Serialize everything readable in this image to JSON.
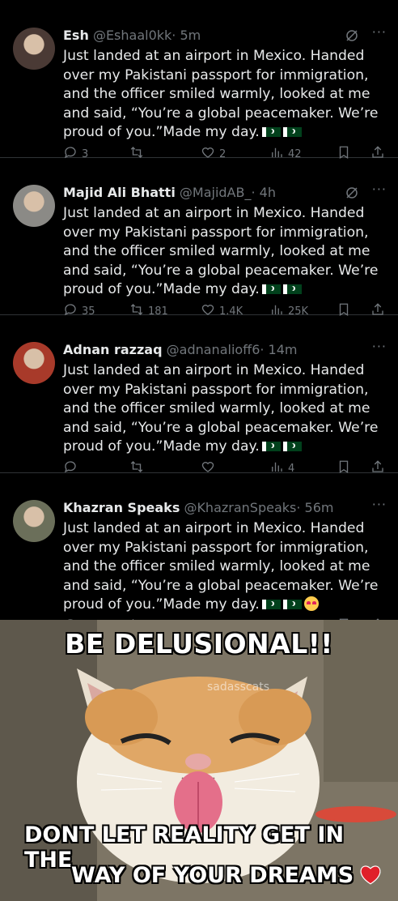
{
  "tweets": [
    {
      "name": "Esh",
      "handle": "@Eshaal0kk",
      "time": "· 5m",
      "text": "Just landed at an airport in Mexico. Handed over my Pakistani passport for immigration, and the officer smiled warmly, looked at me and said, “You’re a global peacemaker. We’re proud of you.”Made my day.",
      "emoji": [
        "flag-pk",
        "flag-pk"
      ],
      "grok": true,
      "replies": "3",
      "reposts": "",
      "likes": "2",
      "views": "42",
      "avatar_color": "#4a3a35"
    },
    {
      "name": "Majid Ali Bhatti",
      "handle": "@MajidAB_",
      "time": "· 4h",
      "text": "Just landed at an airport in Mexico. Handed over my Pakistani passport for immigration, and the officer smiled warmly, looked at me and said, “You’re a global peacemaker. We’re proud of you.”Made my day.",
      "emoji": [
        "flag-pk",
        "flag-pk"
      ],
      "grok": true,
      "replies": "35",
      "reposts": "181",
      "likes": "1.4K",
      "views": "25K",
      "avatar_color": "#8b8a86"
    },
    {
      "name": "Adnan razzaq",
      "handle": "@adnanalioff6",
      "time": "· 14m",
      "text": "Just landed at an airport in Mexico. Handed over my Pakistani passport for immigration, and the officer smiled warmly, looked at me and said, “You’re a global peacemaker. We’re proud of you.”Made my day.",
      "emoji": [
        "flag-pk",
        "flag-pk"
      ],
      "grok": false,
      "replies": "",
      "reposts": "",
      "likes": "",
      "views": "4",
      "avatar_color": "#a83a2a"
    },
    {
      "name": "Khazran Speaks",
      "handle": "@KhazranSpeaks",
      "time": "· 56m",
      "text": "Just landed at an airport in Mexico. Handed over my Pakistani passport for immigration, and the officer smiled warmly, looked at me and said, “You’re a global peacemaker. We’re proud of you.”Made my day.",
      "emoji": [
        "flag-pk",
        "flag-pk",
        "heart-eyes-face"
      ],
      "grok": false,
      "replies": "",
      "reposts": "",
      "likes": "",
      "views": "",
      "avatar_color": "#6b6f5a"
    }
  ],
  "meme": {
    "top": "BE DELUSIONAL!!",
    "bottom_line1": "DONT LET REALITY GET IN THE",
    "bottom_line2": "WAY OF YOUR DREAMS",
    "watermark": "sadasscats"
  },
  "colors": {
    "background": "#000000",
    "text": "#e7e9ea",
    "muted": "#71767b",
    "divider": "#2f3336"
  }
}
